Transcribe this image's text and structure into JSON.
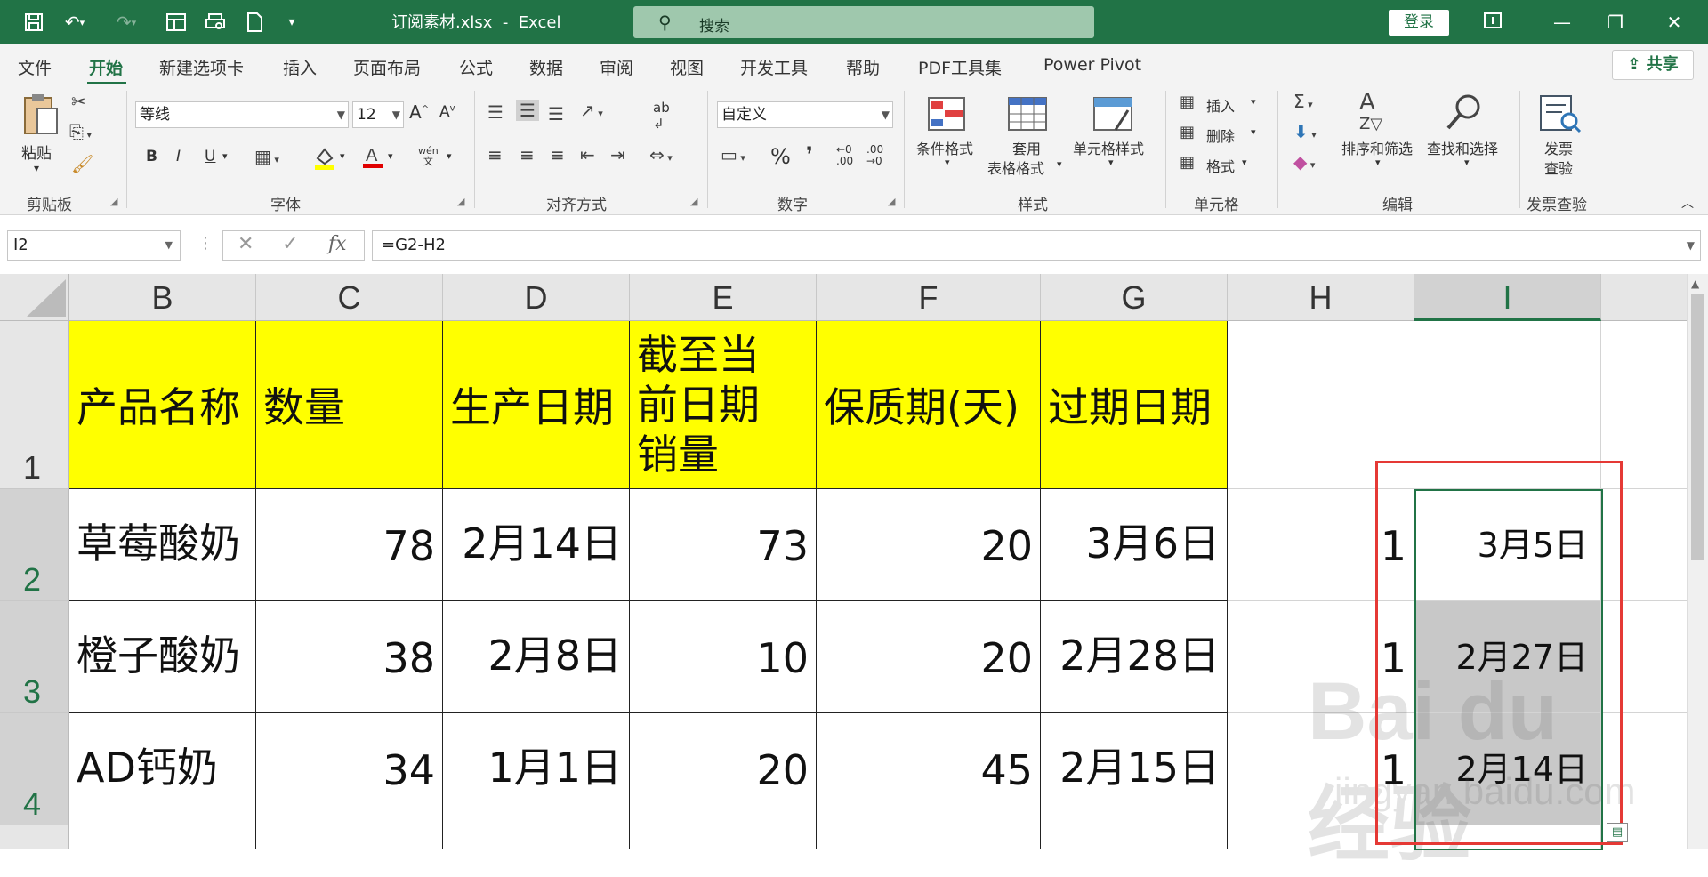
{
  "titlebar": {
    "doc_title": "订阅素材.xlsx  -  Excel",
    "search_placeholder": "搜索",
    "login_label": "登录",
    "qa_icons": [
      "save-icon",
      "undo-icon",
      "redo-icon",
      "form-icon",
      "print-preview-icon",
      "document-icon",
      "customize-dropdown-icon"
    ],
    "window_buttons": [
      "ribbon-display-icon",
      "minimize-icon",
      "restore-icon",
      "close-icon"
    ]
  },
  "menu": {
    "tabs": [
      "文件",
      "开始",
      "新建选项卡",
      "插入",
      "页面布局",
      "公式",
      "数据",
      "审阅",
      "视图",
      "开发工具",
      "帮助",
      "PDF工具集",
      "Power Pivot"
    ],
    "active_tab": "开始",
    "share_label": "共享"
  },
  "ribbon": {
    "clipboard": {
      "paste_label": "粘贴",
      "group_label": "剪贴板"
    },
    "font": {
      "font_name": "等线",
      "font_size": "12",
      "group_label": "字体",
      "bold": "B",
      "italic": "I",
      "underline": "U",
      "wen": "wén"
    },
    "alignment": {
      "group_label": "对齐方式"
    },
    "number": {
      "format": "自定义",
      "percent": "%",
      "comma": "❜",
      "group_label": "数字"
    },
    "styles": {
      "cond_format": "条件格式",
      "table_format_1": "套用",
      "table_format_2": "表格格式",
      "cell_styles": "单元格样式",
      "group_label": "样式"
    },
    "cells": {
      "insert": "插入",
      "delete": "删除",
      "format": "格式",
      "group_label": "单元格"
    },
    "editing": {
      "sort_filter": "排序和筛选",
      "find_select": "查找和选择",
      "group_label": "编辑"
    },
    "invoice": {
      "label_1": "发票",
      "label_2": "查验",
      "group_label": "发票查验"
    }
  },
  "formula_bar": {
    "name_box": "I2",
    "formula": "=G2-H2"
  },
  "sheet": {
    "columns": [
      "B",
      "C",
      "D",
      "E",
      "F",
      "G",
      "H",
      "I"
    ],
    "selected_column": "I",
    "rows": [
      "1",
      "2",
      "3",
      "4"
    ],
    "header_row": [
      "产品名称",
      "数量",
      "生产日期",
      "截至当前日期销量",
      "保质期(天)",
      "过期日期"
    ],
    "data_rows": [
      {
        "name": "草莓酸奶",
        "qty": "78",
        "prod_date": "2月14日",
        "sold": "73",
        "shelf_days": "20",
        "expiry": "3月6日",
        "h": "1",
        "i": "3月5日"
      },
      {
        "name": "橙子酸奶",
        "qty": "38",
        "prod_date": "2月8日",
        "sold": "10",
        "shelf_days": "20",
        "expiry": "2月28日",
        "h": "1",
        "i": "2月27日"
      },
      {
        "name": "AD钙奶",
        "qty": "34",
        "prod_date": "1月1日",
        "sold": "20",
        "shelf_days": "45",
        "expiry": "2月15日",
        "h": "1",
        "i": "2月14日"
      }
    ],
    "selection_color": "#217346",
    "highlight_color": "#e53935",
    "header_fill": "#ffff00"
  },
  "watermark": {
    "brand": "Bai du 经验",
    "url": "jingyan.baidu.com"
  }
}
